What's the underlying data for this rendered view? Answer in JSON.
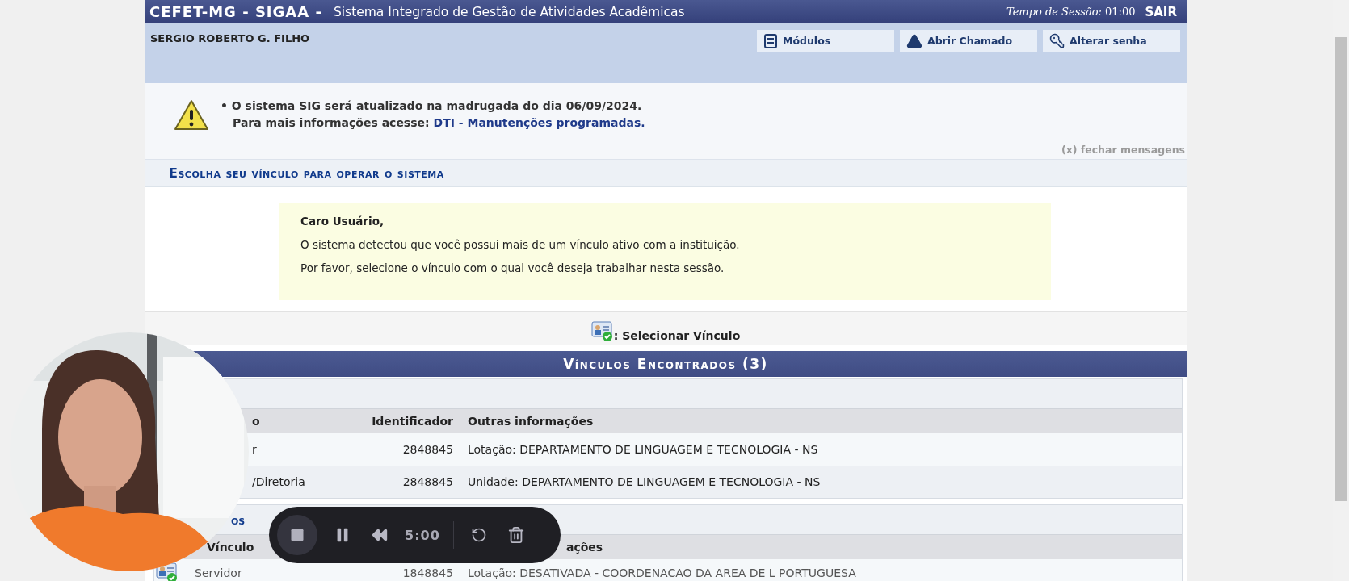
{
  "header": {
    "brand": "CEFET-MG - SIGAA -",
    "title": "Sistema Integrado de Gestão de Atividades Acadêmicas",
    "session_label": "Tempo de Sessão:",
    "session_time": "01:00",
    "logout": "SAIR"
  },
  "user_bar": {
    "user_name": "SERGIO ROBERTO G. FILHO",
    "buttons": [
      {
        "kind": "modules",
        "label": "Módulos"
      },
      {
        "kind": "ticket",
        "label": "Abrir Chamado"
      },
      {
        "kind": "password",
        "label": "Alterar senha"
      }
    ]
  },
  "notice": {
    "bullet": "•",
    "message": "O sistema SIG será atualizado na madrugada do dia 06/09/2024.",
    "more_info": "Para mais informações acesse:",
    "link": "DTI - Manutenções programadas.",
    "close": "(x) fechar mensagens"
  },
  "section_title": "Escolha seu vínculo para operar o sistema",
  "welcome": {
    "greeting": "Caro Usuário,",
    "lines": [
      "O sistema detectou que você possui mais de um vínculo ativo com a instituição.",
      "Por favor, selecione o vínculo com o qual você deseja trabalhar nesta sessão."
    ]
  },
  "legend": ": Selecionar Vínculo",
  "table": {
    "title": "Vínculos Encontrados (3)",
    "groups": [
      {
        "kind": "active",
        "columns": [
          "o",
          "Identificador",
          "Outras informações"
        ],
        "rows": [
          {
            "cells": [
              "r",
              "2848845",
              "Lotação: DEPARTAMENTO DE LINGUAGEM E TECNOLOGIA - NS"
            ]
          },
          {
            "cells": [
              "/Diretoria",
              "2848845",
              "Unidade: DEPARTAMENTO DE LINGUAGEM E TECNOLOGIA - NS"
            ]
          }
        ]
      },
      {
        "kind": "inactive",
        "title": "os",
        "columns": [
          "Vínculo",
          "",
          "ações"
        ],
        "rows": [
          {
            "cells": [
              "Servidor",
              "1848845",
              "Lotação: DESATIVADA - COORDENACAO DA AREA DE L PORTUGUESA"
            ]
          }
        ]
      }
    ]
  },
  "recorder": {
    "time": "5:00"
  }
}
